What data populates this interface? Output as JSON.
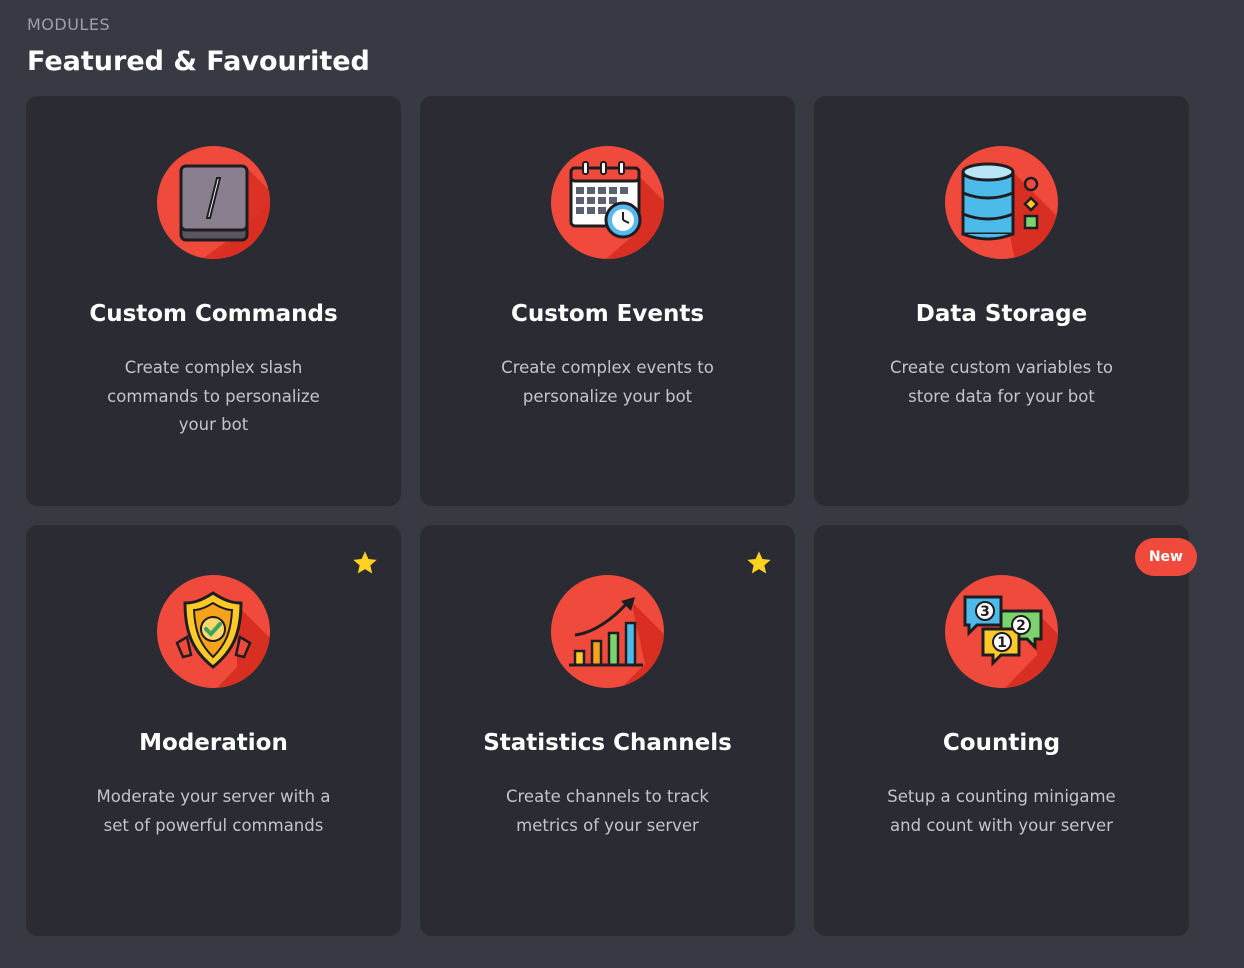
{
  "header": {
    "label": "MODULES",
    "title": "Featured & Favourited"
  },
  "modules": [
    {
      "title": "Custom Commands",
      "description": "Create complex slash commands to personalize your bot",
      "icon": "slash-command-icon",
      "favourite": false
    },
    {
      "title": "Custom Events",
      "description": "Create complex events to personalize your bot",
      "icon": "calendar-clock-icon",
      "favourite": false
    },
    {
      "title": "Data Storage",
      "description": "Create custom variables to store data for your bot",
      "icon": "database-icon",
      "favourite": false
    },
    {
      "title": "Moderation",
      "description": "Moderate your server with a set of powerful commands",
      "icon": "shield-check-icon",
      "favourite": true
    },
    {
      "title": "Statistics Channels",
      "description": "Create channels to track metrics of your server",
      "icon": "bar-chart-icon",
      "favourite": true
    },
    {
      "title": "Counting",
      "description": "Setup a counting minigame and count with your server",
      "icon": "numbered-chat-bubbles-icon",
      "favourite": false,
      "badge": "New"
    }
  ],
  "colors": {
    "background": "#373943",
    "card": "#2b2c33",
    "accent": "#f04a3d",
    "star": "#ffd21f"
  }
}
